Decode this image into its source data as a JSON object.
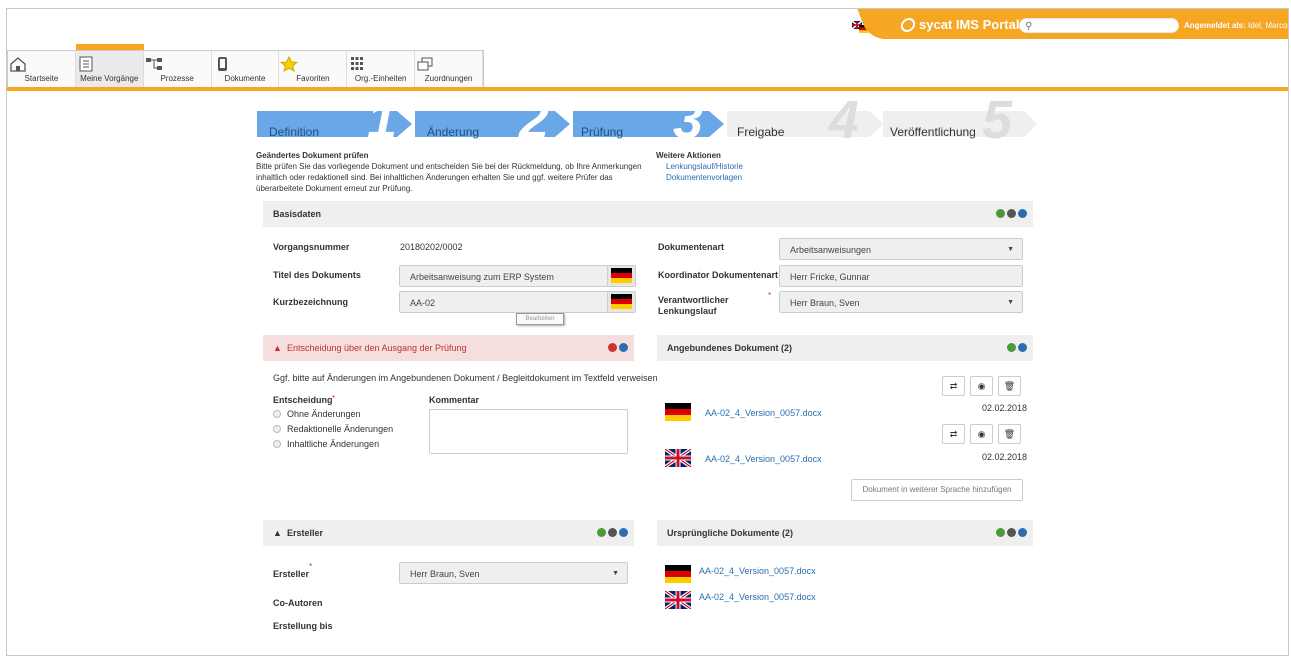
{
  "header": {
    "portal_title": "sycat IMS Portal",
    "search_placeholder": "",
    "login_label": "Angemeldet als:",
    "login_user": "Idel, Marco"
  },
  "nav": {
    "items": [
      {
        "label": "Startseite",
        "icon": "home-icon"
      },
      {
        "label": "Meine Vorgänge",
        "icon": "checklist-icon",
        "active": true
      },
      {
        "label": "Prozesse",
        "icon": "process-icon"
      },
      {
        "label": "Dokumente",
        "icon": "document-icon"
      },
      {
        "label": "Favoriten",
        "icon": "star-icon"
      },
      {
        "label": "Org.-Einheiten",
        "icon": "grid-icon"
      },
      {
        "label": "Zuordnungen",
        "icon": "windows-icon"
      }
    ]
  },
  "steps": [
    {
      "label": "Definition",
      "num": "1"
    },
    {
      "label": "Änderung",
      "num": "2"
    },
    {
      "label": "Prüfung",
      "num": "3"
    },
    {
      "label": "Freigabe",
      "num": "4"
    },
    {
      "label": "Veröffentlichung",
      "num": "5"
    }
  ],
  "description": {
    "title": "Geändertes Dokument prüfen",
    "text": "Bitte prüfen Sie das vorliegende Dokument und entscheiden Sie bei der Rückmeldung, ob Ihre Anmerkungen inhaltlich oder redaktionell sind. Bei inhaltlichen Änderungen erhalten Sie und ggf. weitere Prüfer das überarbeitete Dokument erneut zur Prüfung."
  },
  "weitere": {
    "title": "Weitere Aktionen",
    "links": [
      "Lenkungslauf/Historie",
      "Dokumentenvorlagen"
    ]
  },
  "basisdaten": {
    "title": "Basisdaten",
    "vorgangsnummer_label": "Vorgangsnummer",
    "vorgangsnummer": "20180202/0002",
    "titel_label": "Titel des Dokuments",
    "titel": "Arbeitsanweisung zum ERP System",
    "kurz_label": "Kurzbezeichnung",
    "kurz": "AA-02",
    "dokart_label": "Dokumentenart",
    "dokart": "Arbeitsanweisungen",
    "koord_label": "Koordinator Dokumentenart",
    "koord": "Herr Fricke, Gunnar",
    "verant_label": "Verantwortlicher Lenkungslauf",
    "verant": "Herr Braun, Sven",
    "tooltip": "Bearbeiten"
  },
  "entscheidung": {
    "title": "Entscheidung über den Ausgang der Prüfung",
    "hint": "Ggf. bitte auf Änderungen im Angebundenen Dokument / Begleitdokument im Textfeld verweisen",
    "entscheidung_label": "Entscheidung",
    "kommentar_label": "Kommentar",
    "options": [
      "Ohne Änderungen",
      "Redaktionelle Änderungen",
      "Inhaltliche Änderungen"
    ]
  },
  "angebunden": {
    "title": "Angebundenes Dokument (2)",
    "docs": [
      {
        "name": "AA-02_4_Version_0057.docx",
        "date": "02.02.2018",
        "lang": "de"
      },
      {
        "name": "AA-02_4_Version_0057.docx",
        "date": "02.02.2018",
        "lang": "uk"
      }
    ],
    "add_button": "Dokument in weiterer Sprache hinzufügen"
  },
  "ersteller": {
    "title": "Ersteller",
    "ersteller_label": "Ersteller",
    "ersteller": "Herr Braun, Sven",
    "coautoren_label": "Co-Autoren",
    "bis_label": "Erstellung bis"
  },
  "urspruenglich": {
    "title": "Ursprüngliche Dokumente (2)",
    "docs": [
      {
        "name": "AA-02_4_Version_0057.docx",
        "lang": "de"
      },
      {
        "name": "AA-02_4_Version_0057.docx",
        "lang": "uk"
      }
    ]
  },
  "colors": {
    "accent": "#f5a623",
    "step_active": "#6aa7e6",
    "link": "#2a6db0",
    "alert_bg": "#f7dede"
  }
}
